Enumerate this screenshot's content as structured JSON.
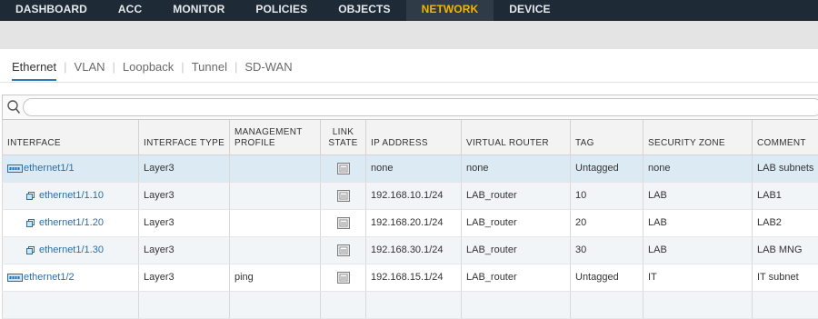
{
  "nav": {
    "items": [
      {
        "label": "DASHBOARD",
        "name": "nav-dashboard"
      },
      {
        "label": "ACC",
        "name": "nav-acc"
      },
      {
        "label": "MONITOR",
        "name": "nav-monitor"
      },
      {
        "label": "POLICIES",
        "name": "nav-policies"
      },
      {
        "label": "OBJECTS",
        "name": "nav-objects"
      },
      {
        "label": "NETWORK",
        "name": "nav-network",
        "active": true
      },
      {
        "label": "DEVICE",
        "name": "nav-device"
      }
    ]
  },
  "tabs": [
    {
      "label": "Ethernet",
      "name": "tab-ethernet",
      "active": true
    },
    {
      "label": "VLAN",
      "name": "tab-vlan"
    },
    {
      "label": "Loopback",
      "name": "tab-loopback"
    },
    {
      "label": "Tunnel",
      "name": "tab-tunnel"
    },
    {
      "label": "SD-WAN",
      "name": "tab-sd-wan"
    }
  ],
  "search": {
    "value": "",
    "placeholder": ""
  },
  "table": {
    "headers": {
      "interface": "INTERFACE",
      "interface_type": "INTERFACE TYPE",
      "management_profile_1": "MANAGEMENT",
      "management_profile_2": "PROFILE",
      "link_state_1": "LINK",
      "link_state_2": "STATE",
      "ip_address": "IP ADDRESS",
      "virtual_router": "VIRTUAL ROUTER",
      "tag": "TAG",
      "security_zone": "SECURITY ZONE",
      "comment": "COMMENT"
    },
    "rows": [
      {
        "interface": "ethernet1/1",
        "icon": "physical-interface-icon",
        "sub": false,
        "style": "sel",
        "interface_type": "Layer3",
        "management_profile": "",
        "ip_address": "none",
        "virtual_router": "none",
        "tag": "Untagged",
        "security_zone": "none",
        "comment": "LAB subnets"
      },
      {
        "interface": "ethernet1/1.10",
        "icon": "subinterface-icon",
        "sub": true,
        "style": "alt",
        "interface_type": "Layer3",
        "management_profile": "",
        "ip_address": "192.168.10.1/24",
        "virtual_router": "LAB_router",
        "tag": "10",
        "security_zone": "LAB",
        "comment": "LAB1"
      },
      {
        "interface": "ethernet1/1.20",
        "icon": "subinterface-icon",
        "sub": true,
        "style": "plain",
        "interface_type": "Layer3",
        "management_profile": "",
        "ip_address": "192.168.20.1/24",
        "virtual_router": "LAB_router",
        "tag": "20",
        "security_zone": "LAB",
        "comment": "LAB2"
      },
      {
        "interface": "ethernet1/1.30",
        "icon": "subinterface-icon",
        "sub": true,
        "style": "alt",
        "interface_type": "Layer3",
        "management_profile": "",
        "ip_address": "192.168.30.1/24",
        "virtual_router": "LAB_router",
        "tag": "30",
        "security_zone": "LAB",
        "comment": "LAB MNG"
      },
      {
        "interface": "ethernet1/2",
        "icon": "physical-interface-icon",
        "sub": false,
        "style": "plain",
        "interface_type": "Layer3",
        "management_profile": "ping",
        "ip_address": "192.168.15.1/24",
        "virtual_router": "LAB_router",
        "tag": "Untagged",
        "security_zone": "IT",
        "comment": "IT subnet"
      },
      {
        "interface": "",
        "icon": "",
        "sub": false,
        "style": "alt",
        "interface_type": "",
        "management_profile": "",
        "ip_address": "",
        "virtual_router": "",
        "tag": "",
        "security_zone": "",
        "comment": ""
      }
    ]
  },
  "colors": {
    "nav_bg": "#1e2b36",
    "nav_active": "#f4b400",
    "link": "#2b6ea5",
    "selected_row": "#dceaf3",
    "tab_underline": "#2b7bb9"
  }
}
